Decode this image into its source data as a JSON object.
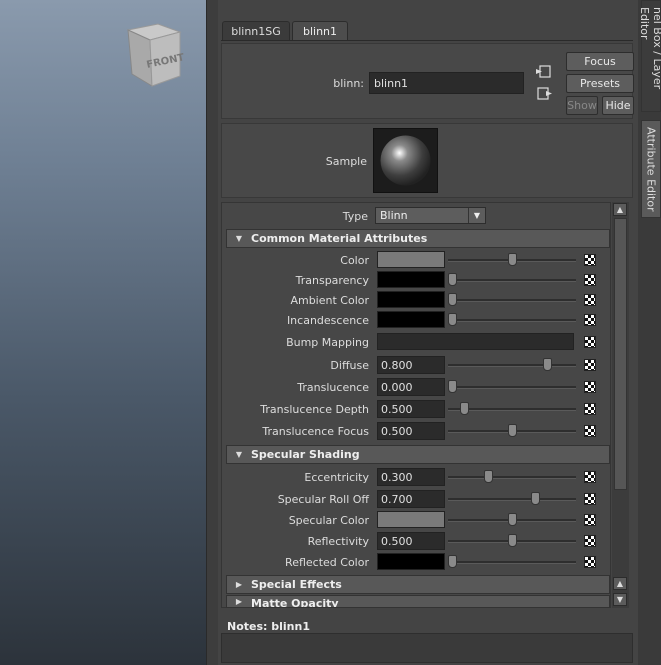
{
  "viewcube": {
    "face_label": "FRONT"
  },
  "side_tabs": {
    "channel_box": "nel Box / Layer Editor",
    "attribute_editor": "Attribute Editor"
  },
  "node_tabs": [
    "blinn1SG",
    "blinn1"
  ],
  "node": {
    "label": "blinn:",
    "name": "blinn1"
  },
  "buttons": {
    "focus": "Focus",
    "presets": "Presets",
    "show": "Show",
    "hide": "Hide"
  },
  "sample": {
    "label": "Sample"
  },
  "type": {
    "label": "Type",
    "value": "Blinn"
  },
  "sections": {
    "common": "Common Material Attributes",
    "specular": "Specular Shading",
    "special": "Special Effects",
    "matte": "Matte Opacity"
  },
  "common_attrs": [
    {
      "label": "Color",
      "kind": "swatch",
      "color": "#7a7a7a",
      "slider": 0.5
    },
    {
      "label": "Transparency",
      "kind": "swatch",
      "color": "#000000",
      "slider": 0.0
    },
    {
      "label": "Ambient Color",
      "kind": "swatch",
      "color": "#000000",
      "slider": 0.0
    },
    {
      "label": "Incandescence",
      "kind": "swatch",
      "color": "#000000",
      "slider": 0.0
    },
    {
      "label": "Bump Mapping",
      "kind": "bump"
    },
    {
      "label": "Diffuse",
      "kind": "number",
      "value": "0.800",
      "slider": 0.8
    },
    {
      "label": "Translucence",
      "kind": "number",
      "value": "0.000",
      "slider": 0.0
    },
    {
      "label": "Translucence Depth",
      "kind": "number",
      "value": "0.500",
      "slider": 0.1
    },
    {
      "label": "Translucence Focus",
      "kind": "number",
      "value": "0.500",
      "slider": 0.5
    }
  ],
  "specular_attrs": [
    {
      "label": "Eccentricity",
      "kind": "number",
      "value": "0.300",
      "slider": 0.3
    },
    {
      "label": "Specular Roll Off",
      "kind": "number",
      "value": "0.700",
      "slider": 0.7
    },
    {
      "label": "Specular Color",
      "kind": "swatch",
      "color": "#7a7a7a",
      "slider": 0.5
    },
    {
      "label": "Reflectivity",
      "kind": "number",
      "value": "0.500",
      "slider": 0.5
    },
    {
      "label": "Reflected Color",
      "kind": "swatch",
      "color": "#000000",
      "slider": 0.0
    }
  ],
  "notes": {
    "label": "Notes:  blinn1"
  }
}
